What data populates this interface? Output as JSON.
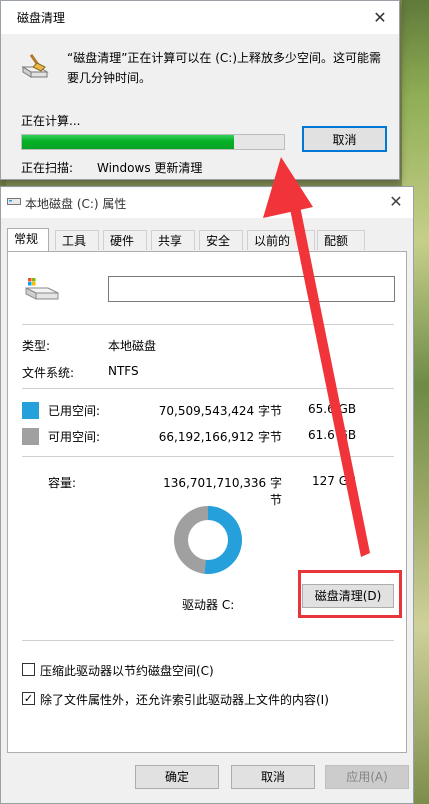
{
  "disk_cleanup": {
    "title": "磁盘清理",
    "close_glyph": "✕",
    "message": "“磁盘清理”正在计算可以在 (C:)上释放多少空间。这可能需要几分钟时间。",
    "calculating_label": "正在计算...",
    "progress_fraction": 0.81,
    "cancel_label": "取消",
    "scanning_label": "正在扫描:",
    "scanning_value": "Windows 更新清理"
  },
  "properties": {
    "title": "本地磁盘 (C:) 属性",
    "close_glyph": "✕",
    "tabs": [
      {
        "label": "常规"
      },
      {
        "label": "工具"
      },
      {
        "label": "硬件"
      },
      {
        "label": "共享"
      },
      {
        "label": "安全"
      },
      {
        "label": "以前的"
      },
      {
        "label": "配额"
      }
    ],
    "volume_name_value": "",
    "type_label": "类型:",
    "type_value": "本地磁盘",
    "fs_label": "文件系统:",
    "fs_value": "NTFS",
    "used_label": "已用空间:",
    "used_bytes": "70,509,543,424 字节",
    "used_size": "65.6 GB",
    "free_label": "可用空间:",
    "free_bytes": "66,192,166,912 字节",
    "free_size": "61.6 GB",
    "capacity_label": "容量:",
    "capacity_bytes": "136,701,710,336 字节",
    "capacity_size": "127 GB",
    "drive_label": "驱动器 C:",
    "disk_cleanup_button": "磁盘清理(D)",
    "compress_label": "压缩此驱动器以节约磁盘空间(C)",
    "compress_checked": false,
    "index_label": "除了文件属性外，还允许索引此驱动器上文件的内容(I)",
    "index_checked": true,
    "ok_label": "确定",
    "cancel_label": "取消",
    "apply_label": "应用(A)",
    "used_fraction": 0.516
  },
  "colors": {
    "used": "#26a0da",
    "free": "#a0a0a0",
    "progress": "#06b025",
    "highlight": "#e8353a",
    "arrow": "#f0343a"
  }
}
